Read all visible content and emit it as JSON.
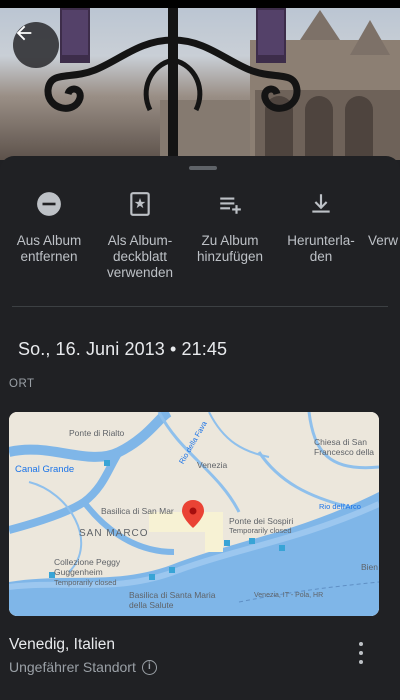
{
  "back": {
    "icon": "arrow-back-icon"
  },
  "actions": [
    {
      "icon": "remove-circle-icon",
      "label": "Aus Album entfernen"
    },
    {
      "icon": "album-cover-icon",
      "label": "Als Album-deckblatt verwenden"
    },
    {
      "icon": "playlist-add-icon",
      "label": "Zu Album hinzufügen"
    },
    {
      "icon": "download-icon",
      "label": "Herunterla-den"
    },
    {
      "icon": "more-actions-icon",
      "label": "Verw"
    }
  ],
  "datetime": "So., 16. Juni 2013 • 21:45",
  "section_label": "ORT",
  "map": {
    "labels": {
      "rialto": "Ponte di Rialto",
      "canal": "Canal Grande",
      "venezia": "Venezia",
      "chiesa": "Chiesa di San Francesco della",
      "rio_fava": "Rio della Fava",
      "rio_arco": "Rio dell'Arco",
      "basilica": "Basilica di San Mar",
      "sospiri": "Ponte dei Sospiri",
      "sospiri_note": "Temporarily closed",
      "san_marco": "SAN MARCO",
      "peggy": "Collezione Peggy Guggenheim",
      "peggy_note": "Temporarily closed",
      "salute": "Basilica di Santa Maria della Salute",
      "bien": "Bien",
      "route": "Venezia, IT - Pola, HR"
    },
    "accent": "#ea4335"
  },
  "location": {
    "title": "Venedig, Italien",
    "subtitle": "Ungefährer Standort",
    "info_icon": "info-icon",
    "more_icon": "more-vert-icon"
  }
}
